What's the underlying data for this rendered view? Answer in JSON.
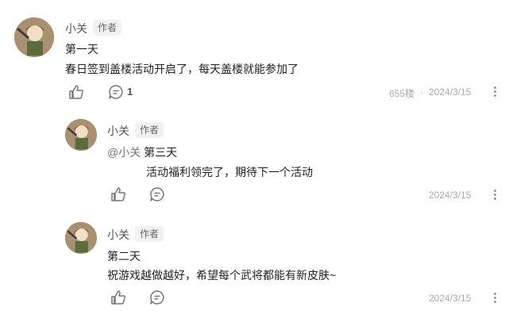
{
  "comments": [
    {
      "author": "小关",
      "badge": "作者",
      "lines": [
        "第一天",
        "春日签到盖楼活动开启了，每天盖楼就能参加了"
      ],
      "reply_count": "1",
      "floor": "655楼",
      "separator": "·",
      "date": "2024/3/15"
    },
    {
      "author": "小关",
      "badge": "作者",
      "mention": "@小关",
      "lines": [
        "第三天",
        "活动福利领完了，期待下一个活动"
      ],
      "date": "2024/3/15"
    },
    {
      "author": "小关",
      "badge": "作者",
      "lines": [
        "第二天",
        "祝游戏越做越好，希望每个武将都能有新皮肤~"
      ],
      "date": "2024/3/15"
    }
  ],
  "icons": {
    "like": "thumbs-up-icon",
    "reply": "comment-bubble-icon",
    "more": "more-vertical-icon"
  }
}
